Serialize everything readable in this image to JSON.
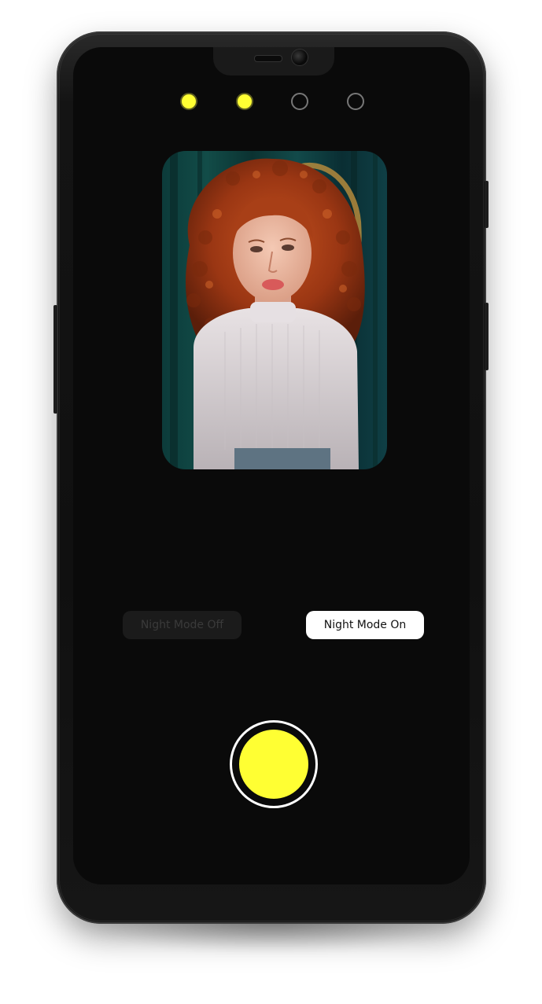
{
  "screen": {
    "step_indicator": {
      "steps": [
        {
          "state": "active"
        },
        {
          "state": "active"
        },
        {
          "state": "inactive"
        },
        {
          "state": "inactive"
        }
      ]
    },
    "preview": {
      "subject": "portrait of woman with curly red hair in white top"
    },
    "mode_toggle": {
      "off_label": "Night Mode Off",
      "on_label": "Night Mode On",
      "selected": "on"
    },
    "shutter": {
      "icon": "shutter-button-icon"
    }
  },
  "colors": {
    "accent": "#ffff33",
    "screen_bg": "#0a0a0a",
    "selected_button_bg": "#ffffff",
    "unselected_button_bg": "#1b1b1b"
  }
}
